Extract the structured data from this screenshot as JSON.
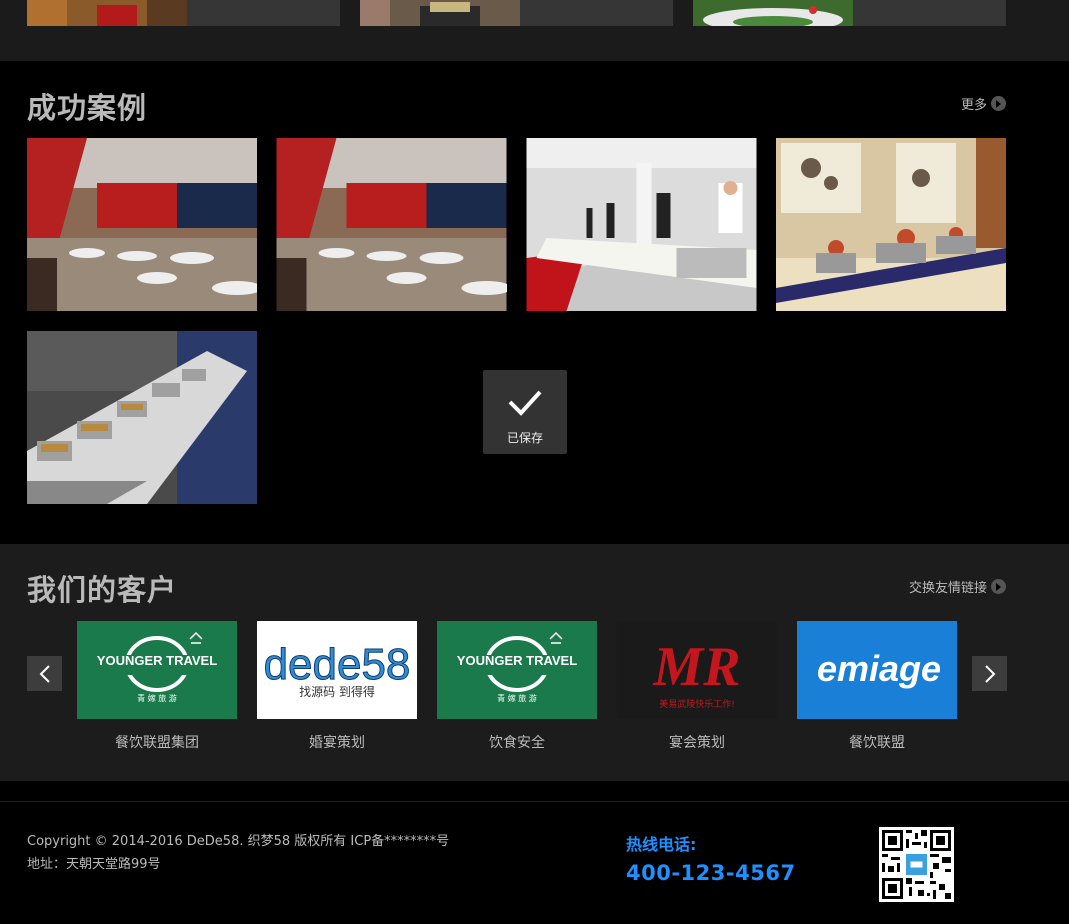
{
  "cases_section": {
    "title": "成功案例",
    "more_label": "更多"
  },
  "toast": {
    "text": "已保存"
  },
  "clients_section": {
    "title": "我们的客户",
    "more_label": "交换友情链接",
    "clients": [
      {
        "name": "餐饮联盟集团",
        "logo": "YOUNGER TRAVEL"
      },
      {
        "name": "婚宴策划",
        "logo": "dede58"
      },
      {
        "name": "饮食安全",
        "logo": "YOUNGER TRAVEL"
      },
      {
        "name": "宴会策划",
        "logo": "MR"
      },
      {
        "name": "餐饮联盟",
        "logo": "emiage"
      }
    ],
    "dede_subtitle": "找源码 到得得",
    "younger_cn": "青 嫁 旅 游",
    "mr_slogan": "美易武陵快乐工作!"
  },
  "footer": {
    "copyright": "Copyright © 2014-2016 DeDe58. 织梦58 版权所有  ICP备********号",
    "address": "地址：天朝天堂路99号",
    "hotline_label": "热线电话:",
    "hotline_number": "400-123-4567"
  },
  "colors": {
    "accent": "#1e90ff",
    "green_logo": "#1b7a4c",
    "blue_logo": "#1a7fd6"
  },
  "icons": [
    "chevron-right-icon",
    "check-icon",
    "chevron-left-icon",
    "qr-code"
  ]
}
